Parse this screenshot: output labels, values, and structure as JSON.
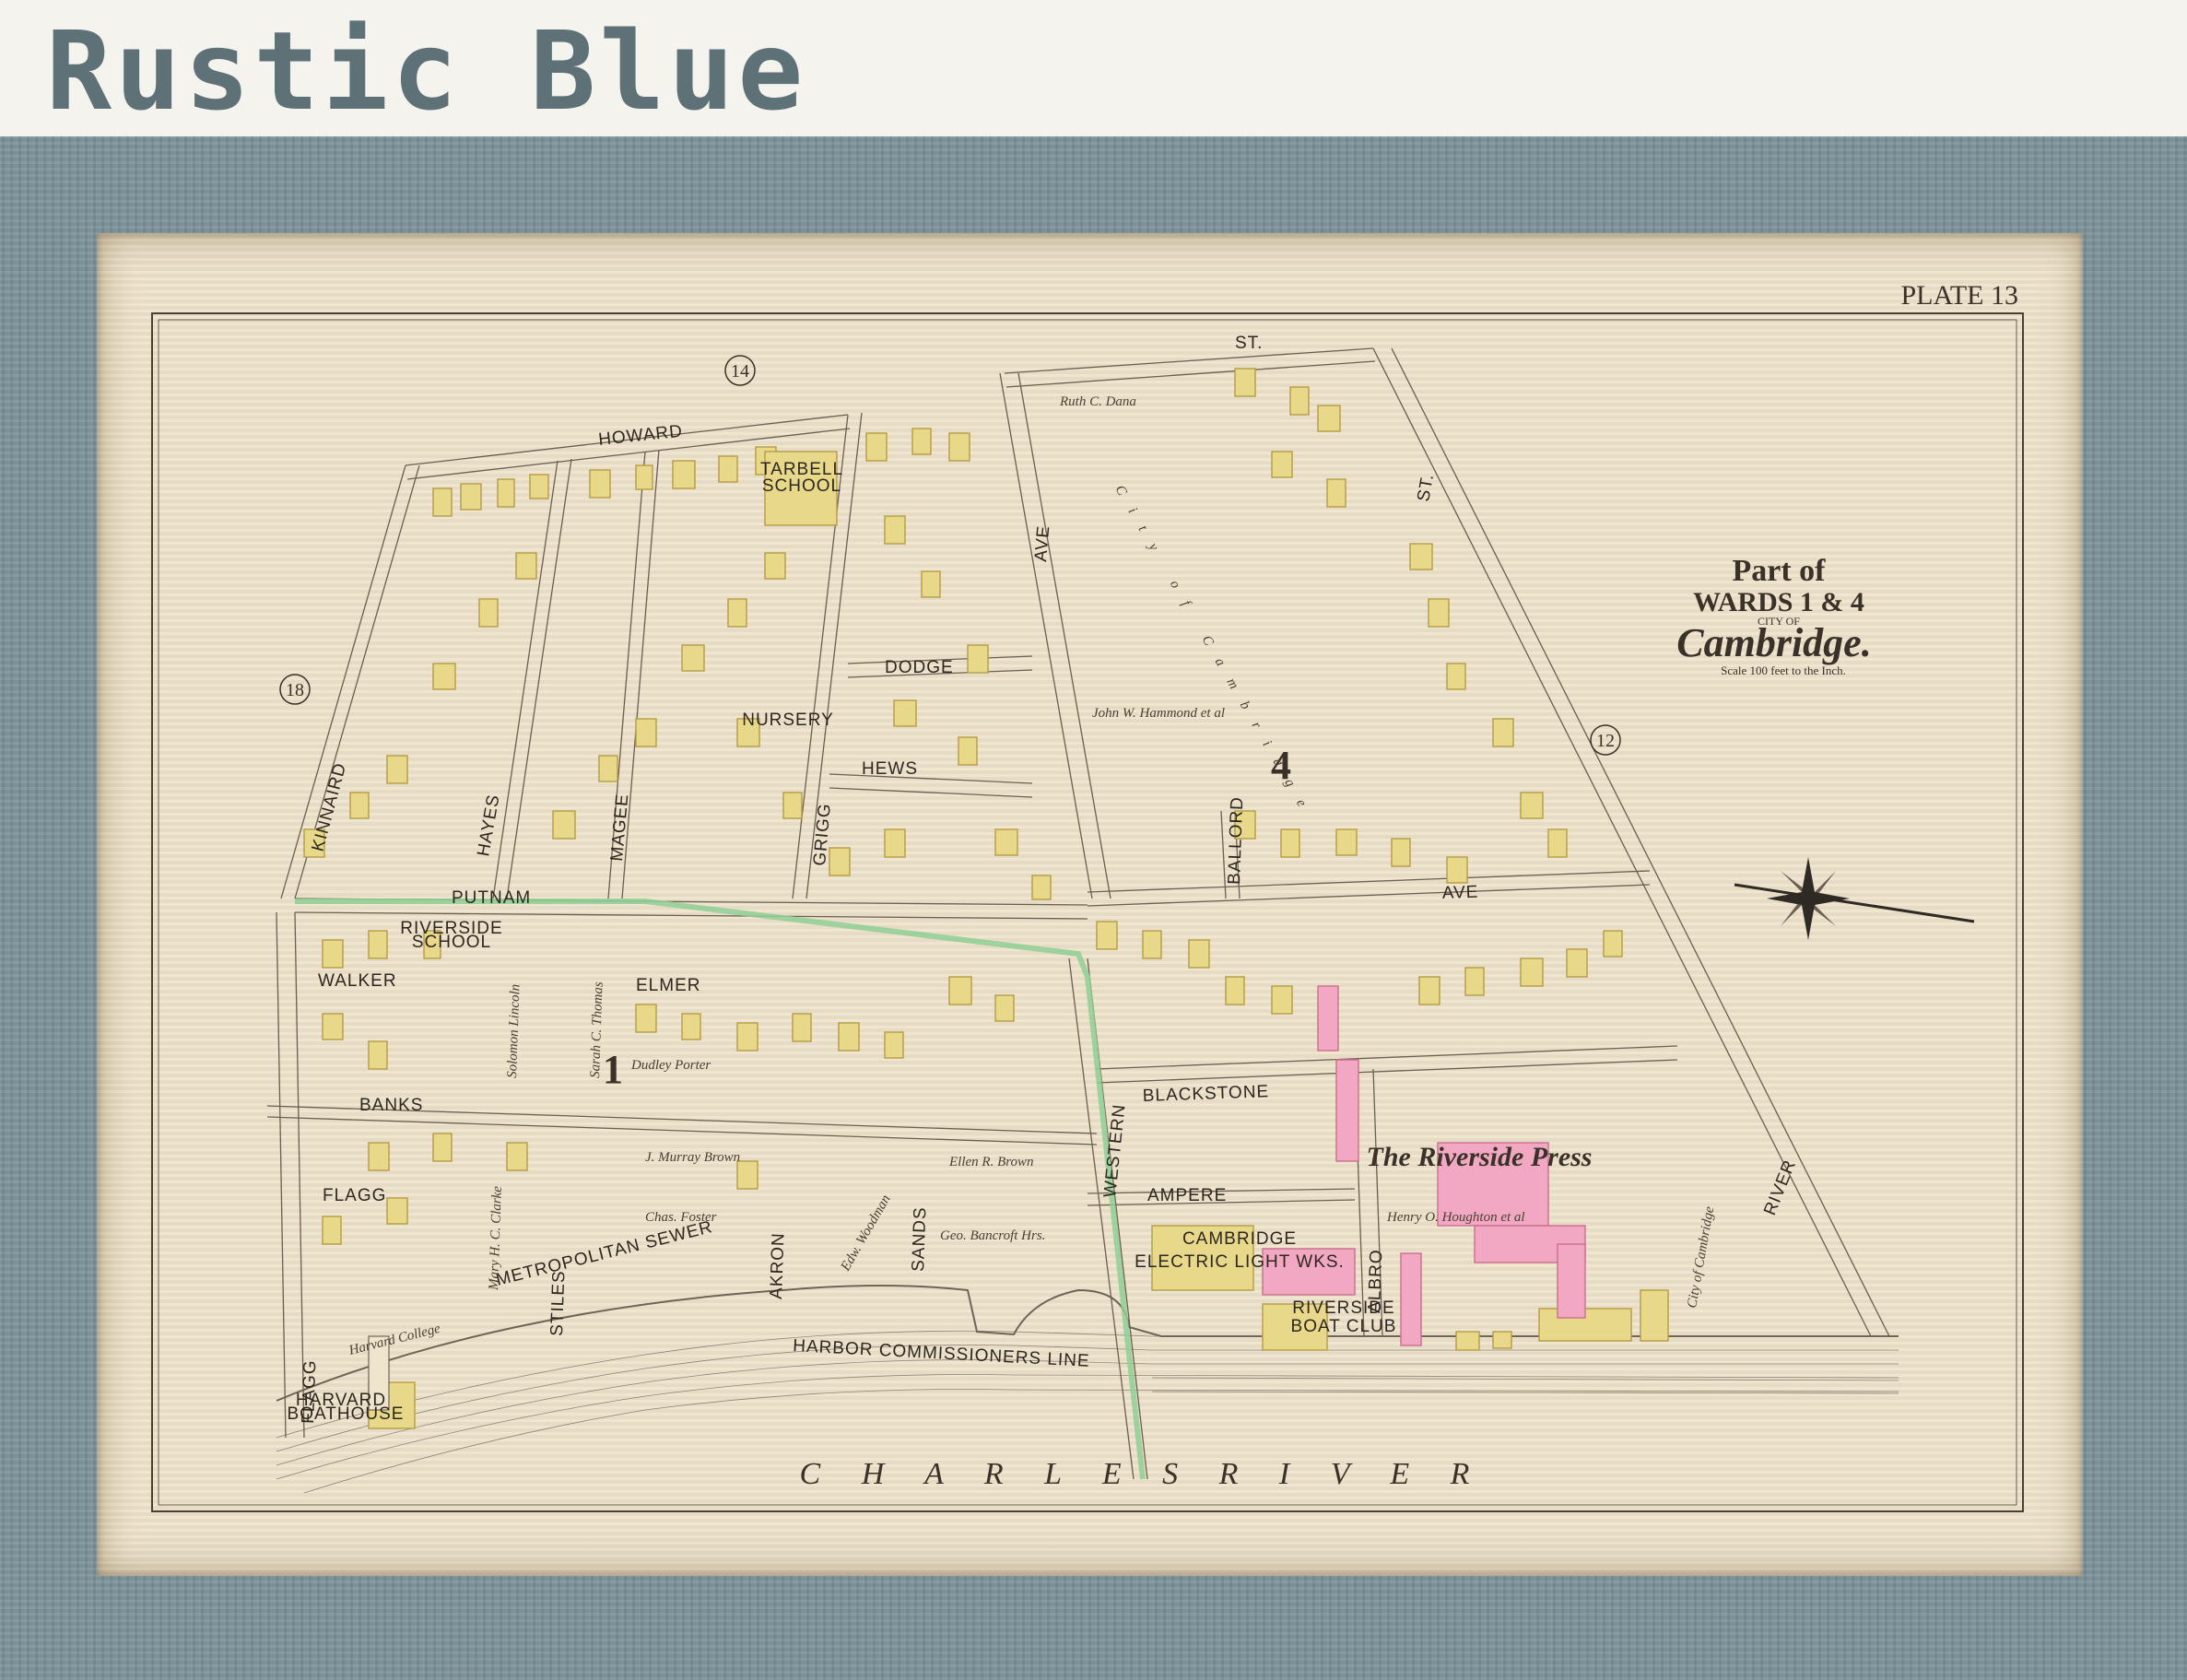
{
  "heading": "Rustic Blue",
  "plate": "PLATE 13",
  "title": {
    "line1": "Part of",
    "line2": "WARDS 1 & 4",
    "city_of": "CITY OF",
    "city": "Cambridge.",
    "scale": "Scale 100 feet to the Inch."
  },
  "ward_numbers": {
    "w14": "14",
    "w18": "18",
    "w12": "12",
    "w4": "4",
    "w1": "1"
  },
  "streets": {
    "st_top": "ST.",
    "howard": "HOWARD",
    "putnam": "PUTNAM",
    "ave_right": "AVE",
    "blackstone": "BLACKSTONE",
    "banks": "BANKS",
    "ampere": "AMPERE",
    "elmer": "ELMER",
    "walker": "WALKER",
    "flagg_ct": "FLAGG",
    "dodge": "DODGE",
    "hews": "HEWS",
    "kinnaird": "KINNAIRD",
    "hayes": "HAYES",
    "magee": "MAGEE",
    "grigg": "GRIGG",
    "western": "WESTERN",
    "river": "RIVER",
    "flagg": "FLAGG",
    "stiles": "STILES",
    "akron": "AKRON",
    "sands": "SANDS",
    "albro": "ALBRO",
    "ballord": "BALLORD",
    "ave_left": "AVE",
    "st_generic": "ST.",
    "metro_sewer": "METROPOLITAN   SEWER",
    "harbor_line": "HARBOR   COMMISSIONERS   LINE"
  },
  "places": {
    "tarbell": "TARBELL",
    "school": "SCHOOL",
    "riverside_school": "RIVERSIDE",
    "nursery": "NURSERY",
    "cambridge_electric": "CAMBRIDGE",
    "electric_light": "ELECTRIC LIGHT WKS.",
    "riverside_press": "The Riverside Press",
    "harvard_boathouse_1": "HARVARD",
    "harvard_boathouse_2": "BOATHOUSE",
    "riverside_boat": "RIVERSIDE",
    "boat_club": "BOAT CLUB",
    "harvard_college": "Harvard College"
  },
  "owners": {
    "dana": "Ruth C. Dana",
    "hammond": "John W. Hammond et al",
    "city_cambridge": "City of Cambridge",
    "houghton": "Henry O. Houghton et al",
    "brown": "Ellen R. Brown",
    "porter": "Dudley Porter",
    "thomas": "Sarah C. Thomas",
    "lincoln": "Solomon Lincoln",
    "clarke": "Mary H. C. Clarke",
    "jmbrown": "J. Murray Brown",
    "bancroft": "Geo. Bancroft Hrs.",
    "foster": "Chas. Foster",
    "woodman": "Edw. Woodman",
    "city_cambridge2": "City of Cambridge"
  },
  "river": "C  H  A  R  L  E  S          R  I  V  E  R"
}
